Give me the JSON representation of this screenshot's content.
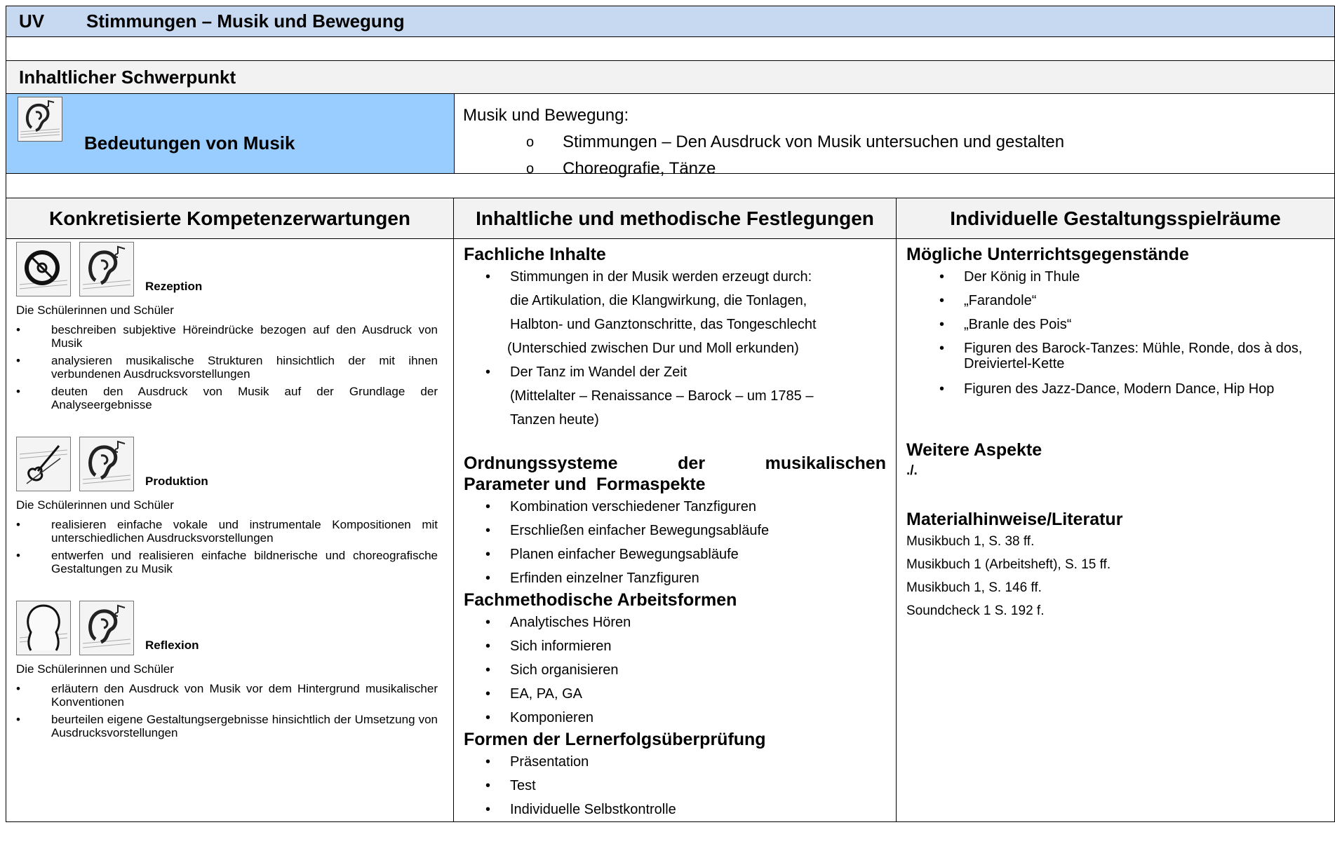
{
  "header": {
    "uv": "UV",
    "title": "Stimmungen – Musik und Bewegung"
  },
  "schwerpunkt": {
    "heading": "Inhaltlicher Schwerpunkt",
    "label": "Bedeutungen von Musik",
    "intro": "Musik und Bewegung:",
    "items": [
      "Stimmungen – Den Ausdruck von Musik untersuchen und gestalten",
      "Choreografie, Tänze"
    ],
    "marker": "o"
  },
  "columns": {
    "c1": "Konkretisierte Kompetenzerwartungen",
    "c2": "Inhaltliche und methodische Festlegungen",
    "c3": "Individuelle Gestaltungsspielräume"
  },
  "bullet": "•",
  "kompetenz": {
    "subject": "Die Schülerinnen und Schüler",
    "rezeption": {
      "label": "Rezeption",
      "items": [
        "beschreiben subjektive Höreindrücke bezogen auf den Ausdruck von Musik",
        "analysieren musikalische Strukturen hinsichtlich der mit ihnen verbundenen Ausdrucksvorstellungen",
        "deuten den Ausdruck von Musik auf der Grundlage der Analyseergebnisse"
      ]
    },
    "produktion": {
      "label": "Produktion",
      "items": [
        "realisieren einfache vokale und instrumentale Kompositionen mit unterschiedlichen Ausdrucksvorstellungen",
        "entwerfen und realisieren einfache bildnerische und choreografische Gestaltungen zu Musik"
      ]
    },
    "reflexion": {
      "label": "Reflexion",
      "items": [
        "erläutern den Ausdruck von Musik vor dem Hintergrund musikalischer Konventionen",
        "beurteilen eigene Gestaltungsergebnisse hinsichtlich der Umsetzung von Ausdrucksvorstellungen"
      ]
    }
  },
  "festlegungen": {
    "fachliche": {
      "heading": "Fachliche Inhalte",
      "item1_lines": [
        "Stimmungen in der Musik werden erzeugt durch:",
        "die Artikulation, die Klangwirkung, die Tonlagen,",
        "Halbton- und Ganztonschritte, das Tongeschlecht",
        "(Unterschied zwischen Dur und Moll erkunden)"
      ],
      "item2_lines": [
        "Der Tanz im Wandel der Zeit",
        "(Mittelalter – Renaissance – Barock – um 1785 –",
        "Tanzen heute)"
      ]
    },
    "ordnung": {
      "heading_line1_a": "Ordnungssysteme",
      "heading_line1_b": "der",
      "heading_line1_c": "musikalischen",
      "heading_line2": "Parameter und  Formaspekte",
      "items": [
        "Kombination verschiedener Tanzfiguren",
        "Erschließen einfacher Bewegungsabläufe",
        "Planen einfacher Bewegungsabläufe",
        "Erfinden einzelner Tanzfiguren"
      ]
    },
    "arbeitsformen": {
      "heading": "Fachmethodische Arbeitsformen",
      "items": [
        "Analytisches Hören",
        "Sich informieren",
        "Sich organisieren",
        "EA, PA, GA",
        "Komponieren"
      ]
    },
    "lernerfolg": {
      "heading": "Formen der Lernerfolgsüberprüfung",
      "items": [
        "Präsentation",
        "Test",
        "Individuelle Selbstkontrolle"
      ]
    }
  },
  "spielraeume": {
    "gegenstaende": {
      "heading": "Mögliche Unterrichtsgegenstände",
      "items": [
        "Der König in Thule",
        "„Farandole“",
        "„Branle des Pois“",
        "Figuren des Barock-Tanzes: Mühle, Ronde, dos à dos, Dreiviertel-Kette",
        "Figuren des Jazz-Dance, Modern Dance, Hip Hop"
      ]
    },
    "weitere": {
      "heading": "Weitere Aspekte",
      "text": "./."
    },
    "material": {
      "heading": "Materialhinweise/Literatur",
      "items": [
        "Musikbuch 1, S. 38 ff.",
        "Musikbuch 1 (Arbeitsheft), S. 15 ff.",
        "Musikbuch 1, S. 146 ff.",
        "Soundcheck 1 S. 192 f."
      ]
    }
  }
}
